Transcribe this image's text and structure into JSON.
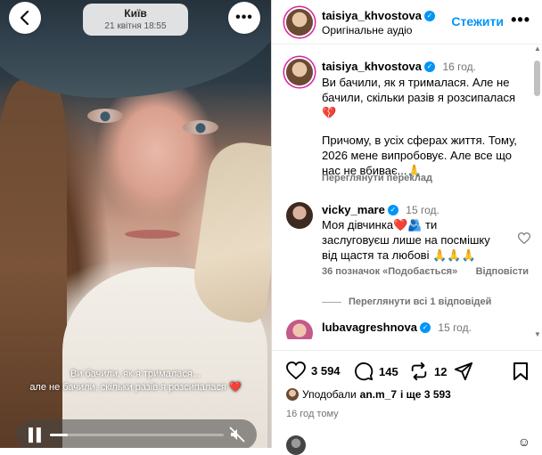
{
  "story": {
    "location": "Київ",
    "date": "21 квітня 18:55",
    "caption_line1": "Ви бачили, як я трималася...",
    "caption_line2": "але не бачили, скільки разів я розсипалася ❤️",
    "progress": 0.1
  },
  "post": {
    "author": "taisiya_khvostova",
    "audio": "Оригінальне аудіо",
    "follow_label": "Стежити",
    "caption_author": "taisiya_khvostova",
    "caption_time": "16 год.",
    "caption_p1": "Ви бачили, як я трималася. Але не бачили, скільки разів я розсипалася 💔",
    "caption_p2": "Причому, в усіх сферах життя. Тому, 2026 мене випробовує. Але все що нас не вбиває...🙏",
    "see_translation": "Переглянути переклад"
  },
  "comments": [
    {
      "user": "vicky_mare",
      "time": "15 год.",
      "text": "Моя дівчинка❤️🫂 ти заслуговуєш лише на посмішку від щастя та любові 🙏🙏🙏",
      "likes": "36 позначок «Подобається»",
      "reply": "Відповісти",
      "view_replies": "Переглянути всі 1 відповідей"
    },
    {
      "user": "lubavagreshnova",
      "time": "15 год."
    }
  ],
  "actions": {
    "likes_count": "3 594",
    "comments_count": "145",
    "reposts_count": "12",
    "liked_by_prefix": "Уподобали",
    "liked_by_user": "an.m_7",
    "liked_by_suffix": "і ще 3 593",
    "timestamp": "16 год тому"
  }
}
